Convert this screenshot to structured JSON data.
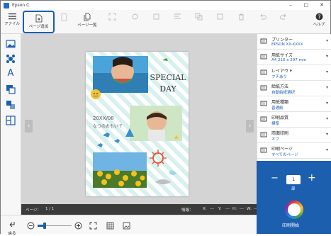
{
  "window": {
    "title": "Epson C"
  },
  "toolbar": {
    "menu_label": "ファイル",
    "add_page_label": "ページ追加",
    "page_list_label": "ページ一覧",
    "help_label": "ヘルプ"
  },
  "page": {
    "special_line1": "SPECIAL",
    "special_line2": "DAY",
    "date_text": "20XX/08",
    "caption_text": "なつのおもいで"
  },
  "status": {
    "page_label": "ページ：",
    "page_value": "1 / 1",
    "info_label": "情報：",
    "x_label": "X:",
    "x_value": "---",
    "y_label": "Y:",
    "y_value": "---",
    "h_label": "H:",
    "h_value": "---",
    "w_label": "W:",
    "w_value": "---"
  },
  "bottom": {
    "back_label": "戻る"
  },
  "settings": [
    {
      "icon": "printer-icon",
      "label": "プリンター",
      "value": "EPSON XX-XXXX"
    },
    {
      "icon": "paper-size-icon",
      "label": "用紙サイズ",
      "value": "A4 210 x 297 mm"
    },
    {
      "icon": "layout-icon",
      "label": "レイアウト",
      "value": "フチあり"
    },
    {
      "icon": "paper-feed-icon",
      "label": "給紙方法",
      "value": "自動給紙選択"
    },
    {
      "icon": "paper-type-icon",
      "label": "用紙種類",
      "value": "普通紙"
    },
    {
      "icon": "quality-icon",
      "label": "印刷品質",
      "value": "標準"
    },
    {
      "icon": "duplex-icon",
      "label": "両面印刷",
      "value": "オフ"
    },
    {
      "icon": "print-pages-icon",
      "label": "印刷ページ",
      "value": "すべてのページ"
    }
  ],
  "print": {
    "copies": "1",
    "unit": "部",
    "start_label": "印刷開始"
  },
  "colors": {
    "accent": "#1b5fae",
    "status_bar": "#3b3b3b",
    "canvas": "#d4d4d4"
  }
}
